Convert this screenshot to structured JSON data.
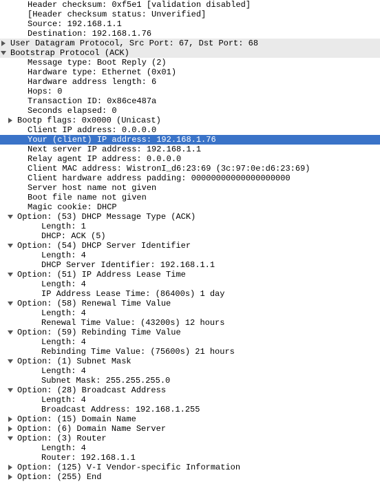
{
  "rows": [
    {
      "indent": 40,
      "arrow": "none",
      "text": "Header checksum: 0xf5e1 [validation disabled]"
    },
    {
      "indent": 40,
      "arrow": "none",
      "text": "[Header checksum status: Unverified]"
    },
    {
      "indent": 40,
      "arrow": "none",
      "text": "Source: 192.168.1.1"
    },
    {
      "indent": 40,
      "arrow": "none",
      "text": "Destination: 192.168.1.76"
    },
    {
      "indent": 10,
      "arrow": "right",
      "text": "User Datagram Protocol, Src Port: 67, Dst Port: 68",
      "hl": "grey",
      "name": "udp-header"
    },
    {
      "indent": 10,
      "arrow": "down",
      "text": "Bootstrap Protocol (ACK)",
      "hl": "grey",
      "name": "bootp-header"
    },
    {
      "indent": 40,
      "arrow": "none",
      "text": "Message type: Boot Reply (2)"
    },
    {
      "indent": 40,
      "arrow": "none",
      "text": "Hardware type: Ethernet (0x01)"
    },
    {
      "indent": 40,
      "arrow": "none",
      "text": "Hardware address length: 6"
    },
    {
      "indent": 40,
      "arrow": "none",
      "text": "Hops: 0"
    },
    {
      "indent": 40,
      "arrow": "none",
      "text": "Transaction ID: 0x86ce487a"
    },
    {
      "indent": 40,
      "arrow": "none",
      "text": "Seconds elapsed: 0"
    },
    {
      "indent": 25,
      "arrow": "right",
      "text": "Bootp flags: 0x0000 (Unicast)",
      "name": "bootp-flags"
    },
    {
      "indent": 40,
      "arrow": "none",
      "text": "Client IP address: 0.0.0.0"
    },
    {
      "indent": 40,
      "arrow": "none",
      "text": "Your (client) IP address: 192.168.1.76",
      "hl": "blue",
      "name": "your-ip-row"
    },
    {
      "indent": 40,
      "arrow": "none",
      "text": "Next server IP address: 192.168.1.1"
    },
    {
      "indent": 40,
      "arrow": "none",
      "text": "Relay agent IP address: 0.0.0.0"
    },
    {
      "indent": 40,
      "arrow": "none",
      "text": "Client MAC address: WistronI_d6:23:69 (3c:97:0e:d6:23:69)"
    },
    {
      "indent": 40,
      "arrow": "none",
      "text": "Client hardware address padding: 00000000000000000000"
    },
    {
      "indent": 40,
      "arrow": "none",
      "text": "Server host name not given"
    },
    {
      "indent": 40,
      "arrow": "none",
      "text": "Boot file name not given"
    },
    {
      "indent": 40,
      "arrow": "none",
      "text": "Magic cookie: DHCP"
    },
    {
      "indent": 25,
      "arrow": "down",
      "text": "Option: (53) DHCP Message Type (ACK)",
      "name": "opt-53"
    },
    {
      "indent": 60,
      "arrow": "none",
      "text": "Length: 1"
    },
    {
      "indent": 60,
      "arrow": "none",
      "text": "DHCP: ACK (5)"
    },
    {
      "indent": 25,
      "arrow": "down",
      "text": "Option: (54) DHCP Server Identifier",
      "name": "opt-54"
    },
    {
      "indent": 60,
      "arrow": "none",
      "text": "Length: 4"
    },
    {
      "indent": 60,
      "arrow": "none",
      "text": "DHCP Server Identifier: 192.168.1.1"
    },
    {
      "indent": 25,
      "arrow": "down",
      "text": "Option: (51) IP Address Lease Time",
      "name": "opt-51"
    },
    {
      "indent": 60,
      "arrow": "none",
      "text": "Length: 4"
    },
    {
      "indent": 60,
      "arrow": "none",
      "text": "IP Address Lease Time: (86400s) 1 day"
    },
    {
      "indent": 25,
      "arrow": "down",
      "text": "Option: (58) Renewal Time Value",
      "name": "opt-58"
    },
    {
      "indent": 60,
      "arrow": "none",
      "text": "Length: 4"
    },
    {
      "indent": 60,
      "arrow": "none",
      "text": "Renewal Time Value: (43200s) 12 hours"
    },
    {
      "indent": 25,
      "arrow": "down",
      "text": "Option: (59) Rebinding Time Value",
      "name": "opt-59"
    },
    {
      "indent": 60,
      "arrow": "none",
      "text": "Length: 4"
    },
    {
      "indent": 60,
      "arrow": "none",
      "text": "Rebinding Time Value: (75600s) 21 hours"
    },
    {
      "indent": 25,
      "arrow": "down",
      "text": "Option: (1) Subnet Mask",
      "name": "opt-1"
    },
    {
      "indent": 60,
      "arrow": "none",
      "text": "Length: 4"
    },
    {
      "indent": 60,
      "arrow": "none",
      "text": "Subnet Mask: 255.255.255.0"
    },
    {
      "indent": 25,
      "arrow": "down",
      "text": "Option: (28) Broadcast Address",
      "name": "opt-28"
    },
    {
      "indent": 60,
      "arrow": "none",
      "text": "Length: 4"
    },
    {
      "indent": 60,
      "arrow": "none",
      "text": "Broadcast Address: 192.168.1.255"
    },
    {
      "indent": 25,
      "arrow": "right",
      "text": "Option: (15) Domain Name",
      "name": "opt-15"
    },
    {
      "indent": 25,
      "arrow": "right",
      "text": "Option: (6) Domain Name Server",
      "name": "opt-6"
    },
    {
      "indent": 25,
      "arrow": "down",
      "text": "Option: (3) Router",
      "name": "opt-3"
    },
    {
      "indent": 60,
      "arrow": "none",
      "text": "Length: 4"
    },
    {
      "indent": 60,
      "arrow": "none",
      "text": "Router: 192.168.1.1"
    },
    {
      "indent": 25,
      "arrow": "right",
      "text": "Option: (125) V-I Vendor-specific Information",
      "name": "opt-125"
    },
    {
      "indent": 25,
      "arrow": "right",
      "text": "Option: (255) End",
      "name": "opt-255"
    }
  ]
}
